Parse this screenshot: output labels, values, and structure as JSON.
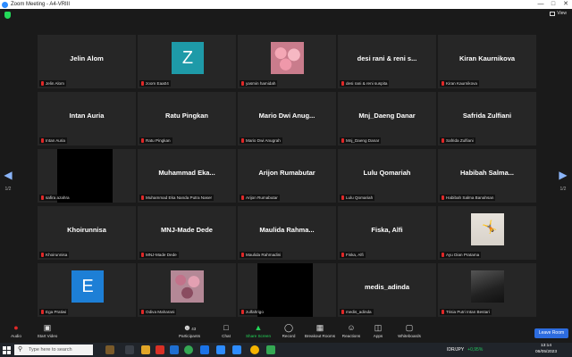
{
  "window": {
    "title": "Zoom Meeting - A4-VRIII"
  },
  "view": {
    "label": "View"
  },
  "pages": {
    "left": "1/2",
    "right": "1/2"
  },
  "tiles": [
    {
      "display": "Jelin Alom",
      "label": "Jelin Alom",
      "type": "name"
    },
    {
      "display": "Z",
      "label": "zoom Eaa04",
      "type": "avatar",
      "color": "#1e9aa8"
    },
    {
      "display": "",
      "label": "yasmin hamidah",
      "type": "photo",
      "photo": "roses"
    },
    {
      "display": "desi rani & reni s...",
      "label": "desi rani & reni suspita",
      "type": "name"
    },
    {
      "display": "Kiran Kaurnikova",
      "label": "Kiran Kaurnikova",
      "type": "name"
    },
    {
      "display": "Intan Auria",
      "label": "Intan Auria",
      "type": "name"
    },
    {
      "display": "Ratu Pingkan",
      "label": "Ratu Pingkan",
      "type": "name"
    },
    {
      "display": "Mario Dwi Anug...",
      "label": "Mario Dwi Anugrah",
      "type": "name"
    },
    {
      "display": "Mnj_Daeng Danar",
      "label": "Mnj_Daeng Danar",
      "type": "name"
    },
    {
      "display": "Safrida Zulfiani",
      "label": "Safrida Zulfiani",
      "type": "name"
    },
    {
      "display": "",
      "label": "safira azahra",
      "type": "black"
    },
    {
      "display": "Muhammad Eka...",
      "label": "Muhammad Eka Nanda Putra Naser",
      "type": "name"
    },
    {
      "display": "Arijon Rumabutar",
      "label": "Arijon Rumabutar",
      "type": "name"
    },
    {
      "display": "Lulu Qomariah",
      "label": "Lulu Qomariah",
      "type": "name"
    },
    {
      "display": "Habibah Salma...",
      "label": "Habibah Salma Banahsan",
      "type": "name"
    },
    {
      "display": "Khoirunnisa",
      "label": "Khoirunnisa",
      "type": "name"
    },
    {
      "display": "MNJ-Made Dede",
      "label": "MNJ-Made Dede",
      "type": "name"
    },
    {
      "display": "Maulida Rahma...",
      "label": "Maulida Rahmadini",
      "type": "name"
    },
    {
      "display": "Fiska, Alfi",
      "label": "Fiska, Alfi",
      "type": "name"
    },
    {
      "display": "",
      "label": "Ayu Dian Pratama",
      "type": "photo",
      "photo": "dancer"
    },
    {
      "display": "E",
      "label": "Ega Pratiwi",
      "type": "avatar",
      "color": "#1d7fd6"
    },
    {
      "display": "",
      "label": "Odiva Maharani",
      "type": "photo",
      "photo": "flowers"
    },
    {
      "display": "",
      "label": "zulfahrigo",
      "type": "black"
    },
    {
      "display": "medis_adinda",
      "label": "medis_adinda",
      "type": "name"
    },
    {
      "display": "",
      "label": "Trisia Putri Intan Bestari",
      "type": "photo",
      "photo": "dark"
    }
  ],
  "toolbar": {
    "audio": "Audio",
    "video": "Start Video",
    "participants": "Participants",
    "participants_count": "43",
    "chat": "Chat",
    "share": "Share Screen",
    "record": "Record",
    "breakout": "Breakout Rooms",
    "reactions": "Reactions",
    "apps": "Apps",
    "whiteboards": "Whiteboards",
    "leave": "Leave Room"
  },
  "taskbar": {
    "search_placeholder": "Type here to search",
    "currency": "IDR/JPY",
    "change": "+0,95%",
    "time": "13:14",
    "date": "06/05/2023"
  },
  "colors": {
    "accent": "#2d8cff",
    "share": "#23d959",
    "mic_off": "#e02828"
  }
}
